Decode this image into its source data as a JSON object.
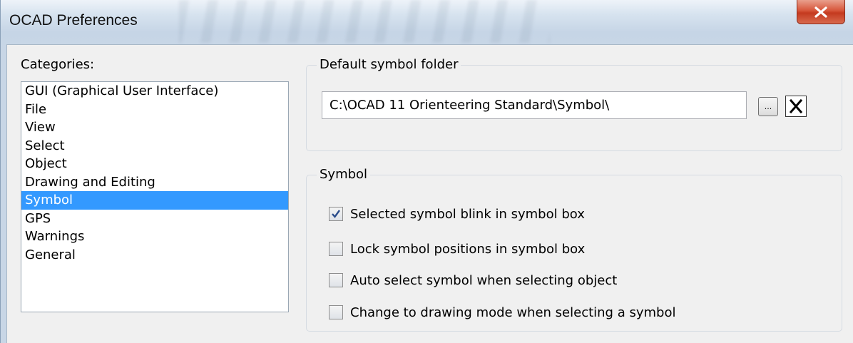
{
  "window": {
    "title": "OCAD Preferences"
  },
  "categories": {
    "label": "Categories:",
    "items": [
      {
        "label": "GUI (Graphical User Interface)",
        "selected": false
      },
      {
        "label": "File",
        "selected": false
      },
      {
        "label": "View",
        "selected": false
      },
      {
        "label": "Select",
        "selected": false
      },
      {
        "label": "Object",
        "selected": false
      },
      {
        "label": "Drawing and Editing",
        "selected": false
      },
      {
        "label": "Symbol",
        "selected": true
      },
      {
        "label": "GPS",
        "selected": false
      },
      {
        "label": "Warnings",
        "selected": false
      },
      {
        "label": "General",
        "selected": false
      }
    ]
  },
  "folder": {
    "legend": "Default symbol folder",
    "path": "C:\\OCAD 11 Orienteering Standard\\Symbol\\",
    "browse_label": "..."
  },
  "symbol": {
    "legend": "Symbol",
    "options": [
      {
        "label": "Selected symbol blink in symbol box",
        "checked": true
      },
      {
        "label": "Lock symbol positions in symbol box",
        "checked": false
      },
      {
        "label": "Auto select symbol when selecting object",
        "checked": false
      },
      {
        "label": "Change to drawing mode when selecting a symbol",
        "checked": false
      }
    ]
  },
  "colors": {
    "selection": "#3399ff",
    "close_button": "#c43a1f"
  }
}
